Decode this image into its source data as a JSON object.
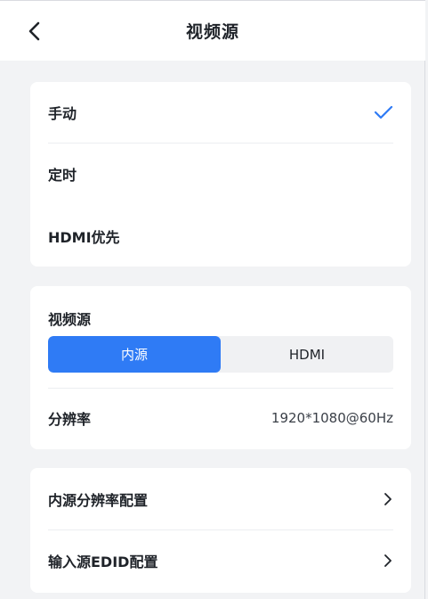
{
  "header": {
    "title": "视频源"
  },
  "mode_list": {
    "items": [
      {
        "label": "手动",
        "selected": true
      },
      {
        "label": "定时",
        "selected": false
      },
      {
        "label": "HDMI优先",
        "selected": false
      }
    ]
  },
  "source_section": {
    "label": "视频源",
    "segments": [
      "内源",
      "HDMI"
    ],
    "active_segment": "内源",
    "resolution_label": "分辨率",
    "resolution_value": "1920*1080@60Hz"
  },
  "config_list": {
    "items": [
      {
        "label": "内源分辨率配置"
      },
      {
        "label": "输入源EDID配置"
      }
    ]
  },
  "colors": {
    "accent": "#2f7bf5",
    "background": "#f2f3f5",
    "card": "#ffffff"
  }
}
